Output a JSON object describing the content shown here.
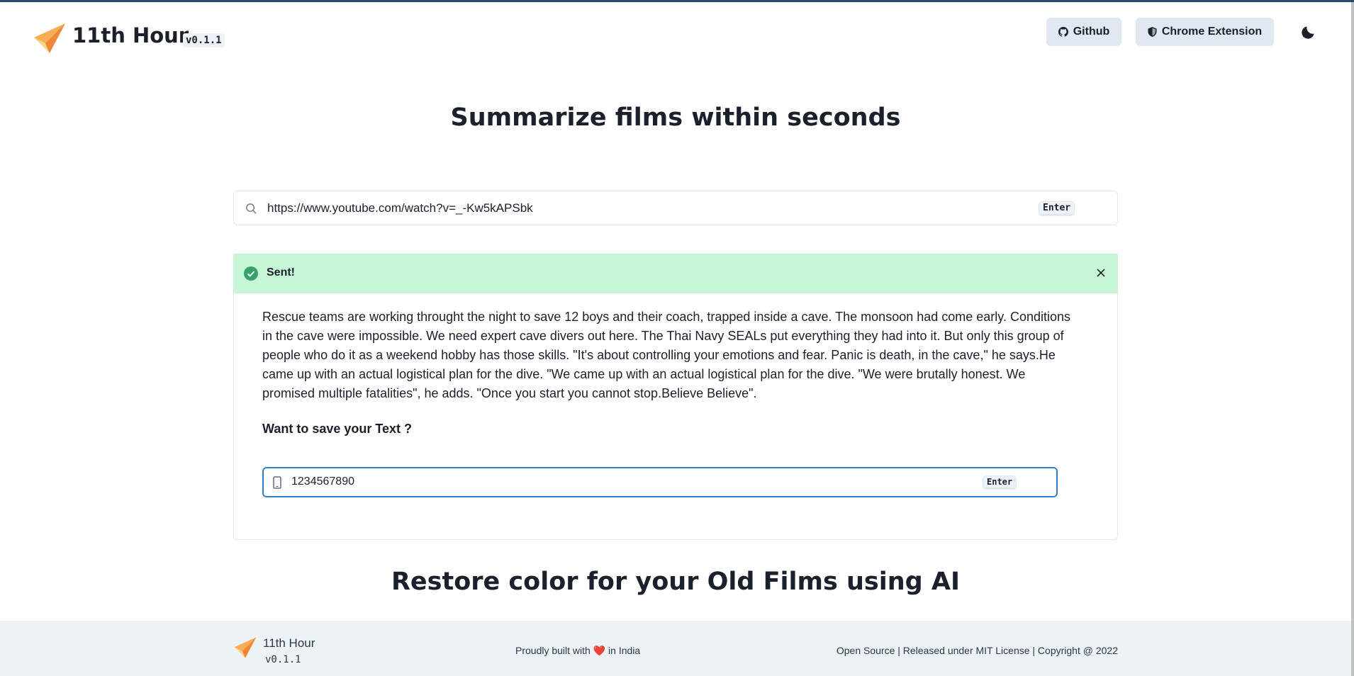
{
  "brand": {
    "name": "11th Hour",
    "version": "v0.1.1"
  },
  "header": {
    "github_label": "Github",
    "chrome_label": "Chrome Extension"
  },
  "main": {
    "title": "Summarize films within seconds",
    "url_value": "https://www.youtube.com/watch?v=_-Kw5kAPSbk",
    "url_enter": "Enter"
  },
  "alert": {
    "title": "Sent!"
  },
  "result": {
    "summary": "Rescue teams are working throught the night to save 12 boys and their coach, trapped inside a cave. The monsoon had come early. Conditions in the cave were impossible. We need expert cave divers out here. The Thai Navy SEALs put everything they had into it. But only this group of people who do it as a weekend hobby has those skills. \"It's about controlling your emotions and fear. Panic is death, in the cave,\" he says.He came up with an actual logistical plan for the dive. \"We came up with an actual logistical plan for the dive. \"We were brutally honest. We promised multiple fatalities\", he adds. \"Once you start you cannot stop.Believe Believe\".",
    "save_question": "Want to save your Text ?",
    "phone_value": "1234567890",
    "phone_enter": "Enter"
  },
  "section2": {
    "title": "Restore color for your Old Films using AI"
  },
  "footer": {
    "name": "11th Hour",
    "version": "v0.1.1",
    "mid_before": "Proudly built with ",
    "heart": "❤️",
    "mid_after": " in India",
    "right": "Open Source | Released under MIT License | Copyright @ 2022"
  },
  "colors": {
    "accent": "#3182ce",
    "success_bg": "#c6f6d5",
    "success_icon": "#38a169",
    "button_bg": "#e2e8f0",
    "footer_bg": "#edf2f7"
  },
  "icons": [
    "paper-plane-icon",
    "github-icon",
    "shield-icon",
    "moon-icon",
    "search-icon",
    "check-circle-icon",
    "close-icon",
    "phone-icon"
  ]
}
